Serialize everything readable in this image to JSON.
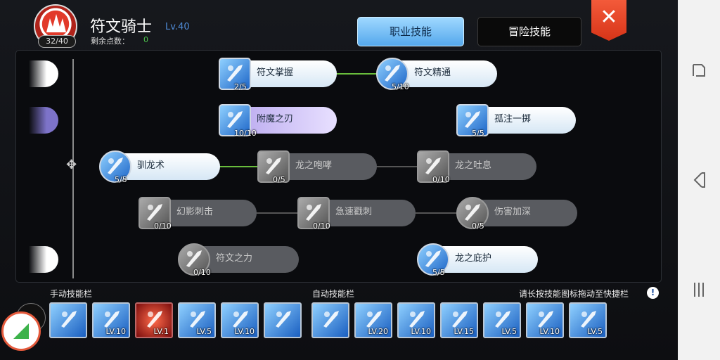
{
  "header": {
    "points_badge": "32/40",
    "class_name": "符文骑士",
    "class_level": "Lv.40",
    "remaining_label": "剩余点数：",
    "remaining_value": "0",
    "tabs": [
      {
        "label": "职业技能",
        "active": true
      },
      {
        "label": "冒险技能",
        "active": false
      }
    ],
    "close_icon": "close-x-icon"
  },
  "skill_tree": [
    {
      "name": "符文掌握",
      "level": "2/5",
      "state": "learned",
      "icon": "rune-lion-icon"
    },
    {
      "name": "符文精通",
      "level": "5/10",
      "state": "learned",
      "icon": "rune-circle-icon"
    },
    {
      "name": "附魔之刃",
      "level": "10/10",
      "state": "enchanted",
      "icon": "enchant-blade-icon"
    },
    {
      "name": "孤注一掷",
      "level": "5/5",
      "state": "learned",
      "icon": "gamble-icon"
    },
    {
      "name": "驯龙术",
      "level": "5/5",
      "state": "learned",
      "icon": "dragon-tame-icon"
    },
    {
      "name": "龙之咆哮",
      "level": "0/5",
      "state": "locked",
      "icon": "dragon-roar-icon"
    },
    {
      "name": "龙之吐息",
      "level": "0/10",
      "state": "locked",
      "icon": "dragon-breath-icon"
    },
    {
      "name": "幻影刺击",
      "level": "0/10",
      "state": "locked",
      "icon": "phantom-stab-icon"
    },
    {
      "name": "急速戳刺",
      "level": "0/10",
      "state": "locked",
      "icon": "rapid-thrust-icon"
    },
    {
      "name": "伤害加深",
      "level": "0/5",
      "state": "locked",
      "icon": "damage-boost-icon"
    },
    {
      "name": "符文之力",
      "level": "0/10",
      "state": "locked",
      "icon": "rune-power-icon"
    },
    {
      "name": "龙之庇护",
      "level": "5/5",
      "state": "learned",
      "icon": "dragon-shield-icon"
    }
  ],
  "bottom": {
    "manual_bar_title": "手动技能栏",
    "auto_bar_title": "自动技能栏",
    "hint": "请长按技能图标拖动至快捷栏",
    "info_icon": "!",
    "manual_slots": [
      {
        "level": "",
        "icon": "sword-slash-icon"
      },
      {
        "level": "LV.10",
        "icon": "sparkle-icon"
      },
      {
        "level": "LV.1",
        "icon": "fire-burst-icon"
      },
      {
        "level": "LV.5",
        "icon": "gamble-icon"
      },
      {
        "level": "LV.10",
        "icon": "enchant-blade-icon"
      },
      {
        "level": "",
        "icon": "rune-lion-icon"
      }
    ],
    "auto_slots": [
      {
        "level": "",
        "icon": "sword-slash-icon"
      },
      {
        "level": "LV.20",
        "icon": "blade-strike-icon"
      },
      {
        "level": "LV.10",
        "icon": "figure-icon"
      },
      {
        "level": "LV.15",
        "icon": "sparkle-icon"
      },
      {
        "level": "LV.5",
        "icon": "dragon-tame-icon"
      },
      {
        "level": "LV.10",
        "icon": "enchant-blade-icon"
      },
      {
        "level": "LV.5",
        "icon": "gamble-icon"
      }
    ]
  },
  "system_nav": [
    {
      "icon": "recents-icon"
    },
    {
      "icon": "back-icon"
    },
    {
      "icon": "menu-lines-icon"
    }
  ]
}
